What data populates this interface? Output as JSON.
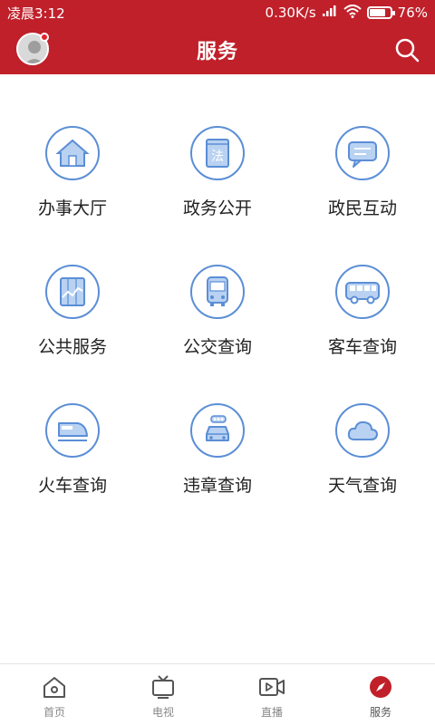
{
  "status_bar": {
    "time": "凌晨3:12",
    "network_speed": "0.30K/s",
    "battery_percent": "76%",
    "battery_level": 0.76
  },
  "header": {
    "title": "服务",
    "avatar_icon": "user-avatar-icon",
    "search_icon": "search-icon"
  },
  "services": [
    {
      "label": "办事大厅",
      "icon": "house-icon"
    },
    {
      "label": "政务公开",
      "icon": "law-book-icon"
    },
    {
      "label": "政民互动",
      "icon": "chat-bubble-icon"
    },
    {
      "label": "公共服务",
      "icon": "chart-board-icon"
    },
    {
      "label": "公交查询",
      "icon": "bus-front-icon"
    },
    {
      "label": "客车查询",
      "icon": "coach-bus-icon"
    },
    {
      "label": "火车查询",
      "icon": "train-icon"
    },
    {
      "label": "违章查询",
      "icon": "car-traffic-icon"
    },
    {
      "label": "天气查询",
      "icon": "cloud-icon"
    }
  ],
  "bottom_nav": [
    {
      "label": "首页",
      "icon": "home-icon",
      "active": false
    },
    {
      "label": "电视",
      "icon": "tv-icon",
      "active": false
    },
    {
      "label": "直播",
      "icon": "live-video-icon",
      "active": false
    },
    {
      "label": "服务",
      "icon": "compass-icon",
      "active": true
    }
  ],
  "colors": {
    "brand_red": "#c0202a",
    "icon_blue": "#5b8ed6",
    "icon_light_blue": "#b9d2f2"
  }
}
